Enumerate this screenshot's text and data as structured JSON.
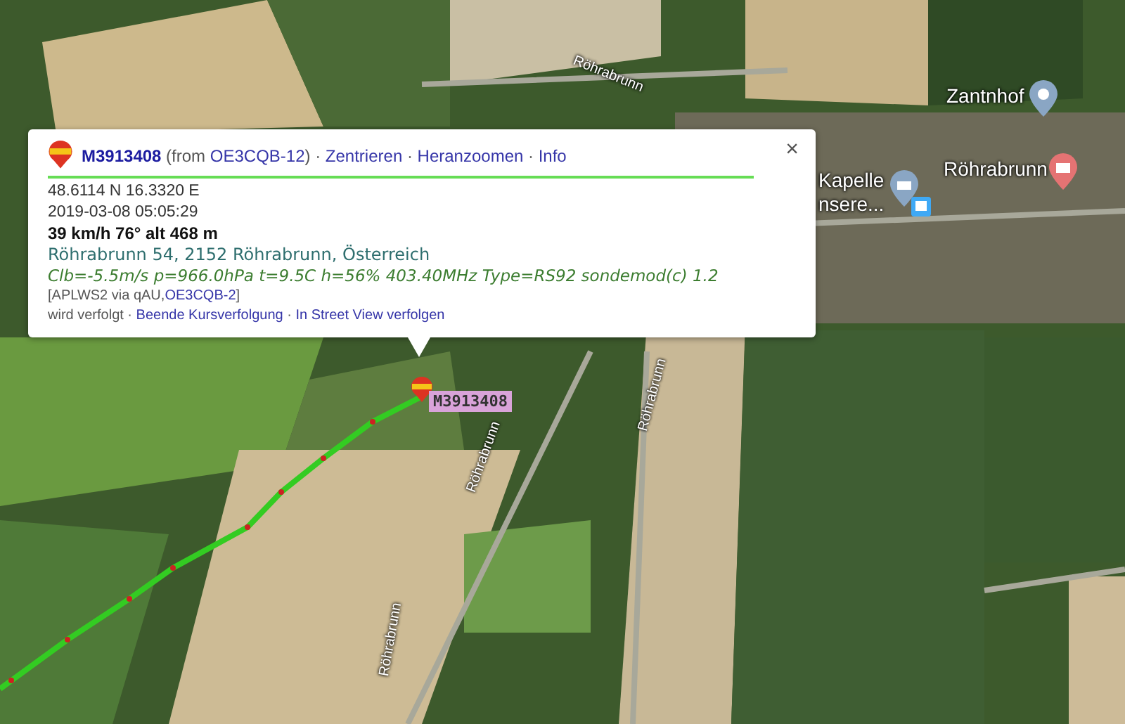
{
  "map": {
    "labels": [
      {
        "kind": "road",
        "text": "Röhrabrunn"
      },
      {
        "kind": "road",
        "text": "Röhrabrunn"
      },
      {
        "kind": "road",
        "text": "Röhrabrunn"
      },
      {
        "kind": "road",
        "text": "Röhrabrunn"
      },
      {
        "kind": "place",
        "text": "Zantnhof"
      },
      {
        "kind": "place",
        "text": "Röhrabrunn"
      },
      {
        "kind": "place",
        "text": "Kapelle"
      },
      {
        "kind": "place",
        "text": "nsere..."
      }
    ],
    "marker": {
      "label": "M3913408"
    }
  },
  "popup": {
    "header": [
      {
        "kind": "title",
        "text": "M3913408"
      },
      {
        "kind": "text",
        "text": " (from "
      },
      {
        "kind": "link",
        "text": "OE3CQB-12"
      },
      {
        "kind": "text",
        "text": ") · "
      },
      {
        "kind": "link",
        "text": "Zentrieren"
      },
      {
        "kind": "text",
        "text": " · "
      },
      {
        "kind": "link",
        "text": "Heranzoomen"
      },
      {
        "kind": "text",
        "text": " · "
      },
      {
        "kind": "link",
        "text": "Info"
      }
    ],
    "close": "×",
    "position": "48.6114 N 16.3320 E",
    "time": "2019-03-08 05:05:29",
    "motion": "39 km/h 76° alt 468 m",
    "address": "Röhrabrunn 54, 2152 Röhrabrunn, Österreich",
    "comment": "Clb=-5.5m/s p=966.0hPa t=9.5C h=56% 403.40MHz Type=RS92 sondemod(c) 1.2",
    "path": [
      {
        "kind": "text",
        "text": "[APLWS2 via qAU,"
      },
      {
        "kind": "link",
        "text": "OE3CQB-2"
      },
      {
        "kind": "text",
        "text": "]"
      }
    ],
    "tracking": [
      {
        "kind": "text",
        "text": "wird verfolgt"
      },
      {
        "kind": "text",
        "text": " · "
      },
      {
        "kind": "link",
        "text": "Beende Kursverfolgung"
      },
      {
        "kind": "text",
        "text": " · "
      },
      {
        "kind": "link",
        "text": "In Street View verfolgen"
      }
    ]
  }
}
